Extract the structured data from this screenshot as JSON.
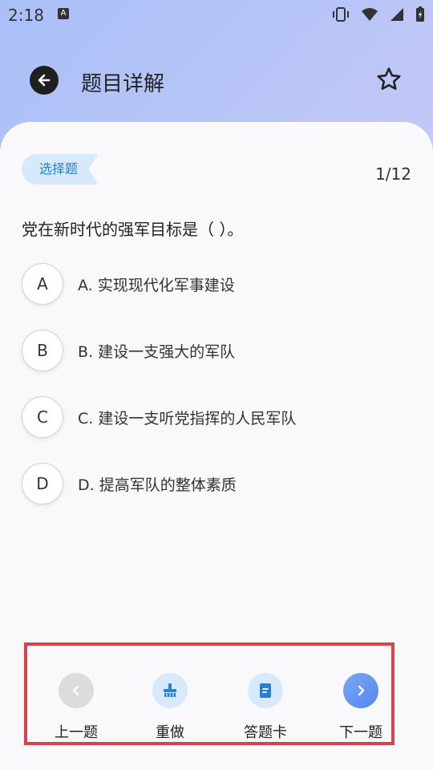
{
  "status_bar": {
    "time": "2:18",
    "notification_letter": "A"
  },
  "header": {
    "title": "题目详解"
  },
  "question": {
    "tag": "选择题",
    "progress": "1/12",
    "text": "党在新时代的强军目标是（ ）。",
    "options": [
      {
        "letter": "A",
        "text": "A. 实现现代化军事建设"
      },
      {
        "letter": "B",
        "text": "B. 建设一支强大的军队"
      },
      {
        "letter": "C",
        "text": "C. 建设一支听党指挥的人民军队"
      },
      {
        "letter": "D",
        "text": "D. 提高军队的整体素质"
      }
    ]
  },
  "bottom_nav": {
    "prev": "上一题",
    "redo": "重做",
    "answer_card": "答题卡",
    "next": "下一题"
  },
  "colors": {
    "tag_bg": "#d6eafc",
    "tag_text": "#2a7fd4",
    "highlight_border": "#d94346",
    "next_button": "#5b8ef0"
  }
}
